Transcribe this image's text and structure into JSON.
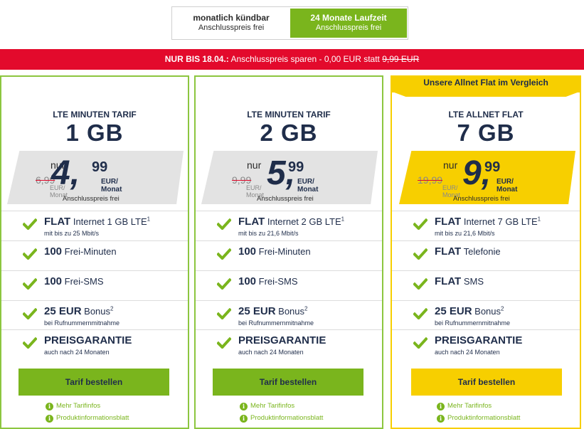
{
  "toggle": {
    "option_a": {
      "title": "monatlich kündbar",
      "sub": "Anschlusspreis frei"
    },
    "option_b": {
      "title": "24 Monate Laufzeit",
      "sub": "Anschlusspreis frei"
    }
  },
  "promo": {
    "bold": "NUR BIS 18.04.:",
    "text": " Anschlusspreis sparen - 0,00 EUR statt ",
    "struck": "9,99 EUR"
  },
  "colors": {
    "green": "#7ab51d",
    "red": "#e30a2c",
    "yellow": "#f7cf00",
    "navy": "#1f2d4a"
  },
  "cards": [
    {
      "ribbon": "",
      "name": "LTE MINUTEN TARIF",
      "gb": "1 GB",
      "nur": "nur",
      "old_price": "6,99",
      "old_unit": "EUR/ Monat",
      "price_main": "4,",
      "price_cents": "99",
      "price_unit": "EUR/ Monat",
      "anschluss": "Anschlusspreis frei",
      "features": [
        {
          "bold": "FLAT",
          "text": " Internet 1 GB LTE",
          "sup": "1",
          "sub": "mit bis zu 25 Mbit/s"
        },
        {
          "bold": "100",
          "text": " Frei-Minuten",
          "sup": "",
          "sub": ""
        },
        {
          "bold": "100",
          "text": " Frei-SMS",
          "sup": "",
          "sub": ""
        },
        {
          "bold": "25 EUR",
          "text": " Bonus",
          "sup": "2",
          "sub": "bei Rufnummernmitnahme"
        },
        {
          "bold": "PREISGARANTIE",
          "text": "",
          "sup": "",
          "sub": "auch nach 24 Monaten"
        }
      ],
      "button": "Tarif bestellen",
      "link1": "Mehr Tarifinfos",
      "link2": "Produktinformationsblatt"
    },
    {
      "ribbon": "",
      "name": "LTE MINUTEN TARIF",
      "gb": "2 GB",
      "nur": "nur",
      "old_price": "9,99",
      "old_unit": "EUR/ Monat",
      "price_main": "5,",
      "price_cents": "99",
      "price_unit": "EUR/ Monat",
      "anschluss": "Anschlusspreis frei",
      "features": [
        {
          "bold": "FLAT",
          "text": " Internet 2 GB LTE",
          "sup": "1",
          "sub": "mit bis zu 21,6 Mbit/s"
        },
        {
          "bold": "100",
          "text": " Frei-Minuten",
          "sup": "",
          "sub": ""
        },
        {
          "bold": "100",
          "text": " Frei-SMS",
          "sup": "",
          "sub": ""
        },
        {
          "bold": "25 EUR",
          "text": " Bonus",
          "sup": "2",
          "sub": "bei Rufnummernmitnahme"
        },
        {
          "bold": "PREISGARANTIE",
          "text": "",
          "sup": "",
          "sub": "auch nach 24 Monaten"
        }
      ],
      "button": "Tarif bestellen",
      "link1": "Mehr Tarifinfos",
      "link2": "Produktinformationsblatt"
    },
    {
      "ribbon": "Unsere Allnet Flat im Vergleich",
      "name": "LTE ALLNET FLAT",
      "gb": "7 GB",
      "nur": "nur",
      "old_price": "19,99",
      "old_unit": "EUR/ Monat",
      "price_main": "9,",
      "price_cents": "99",
      "price_unit": "EUR/ Monat",
      "anschluss": "Anschlusspreis frei",
      "features": [
        {
          "bold": "FLAT",
          "text": " Internet 7 GB LTE",
          "sup": "1",
          "sub": "mit bis zu 21,6 Mbit/s"
        },
        {
          "bold": "FLAT",
          "text": " Telefonie",
          "sup": "",
          "sub": ""
        },
        {
          "bold": "FLAT",
          "text": " SMS",
          "sup": "",
          "sub": ""
        },
        {
          "bold": "25 EUR",
          "text": " Bonus",
          "sup": "2",
          "sub": "bei Rufnummernmitnahme"
        },
        {
          "bold": "PREISGARANTIE",
          "text": "",
          "sup": "",
          "sub": "auch nach 24 Monaten"
        }
      ],
      "button": "Tarif bestellen",
      "link1": "Mehr Tarifinfos",
      "link2": "Produktinformationsblatt"
    }
  ]
}
